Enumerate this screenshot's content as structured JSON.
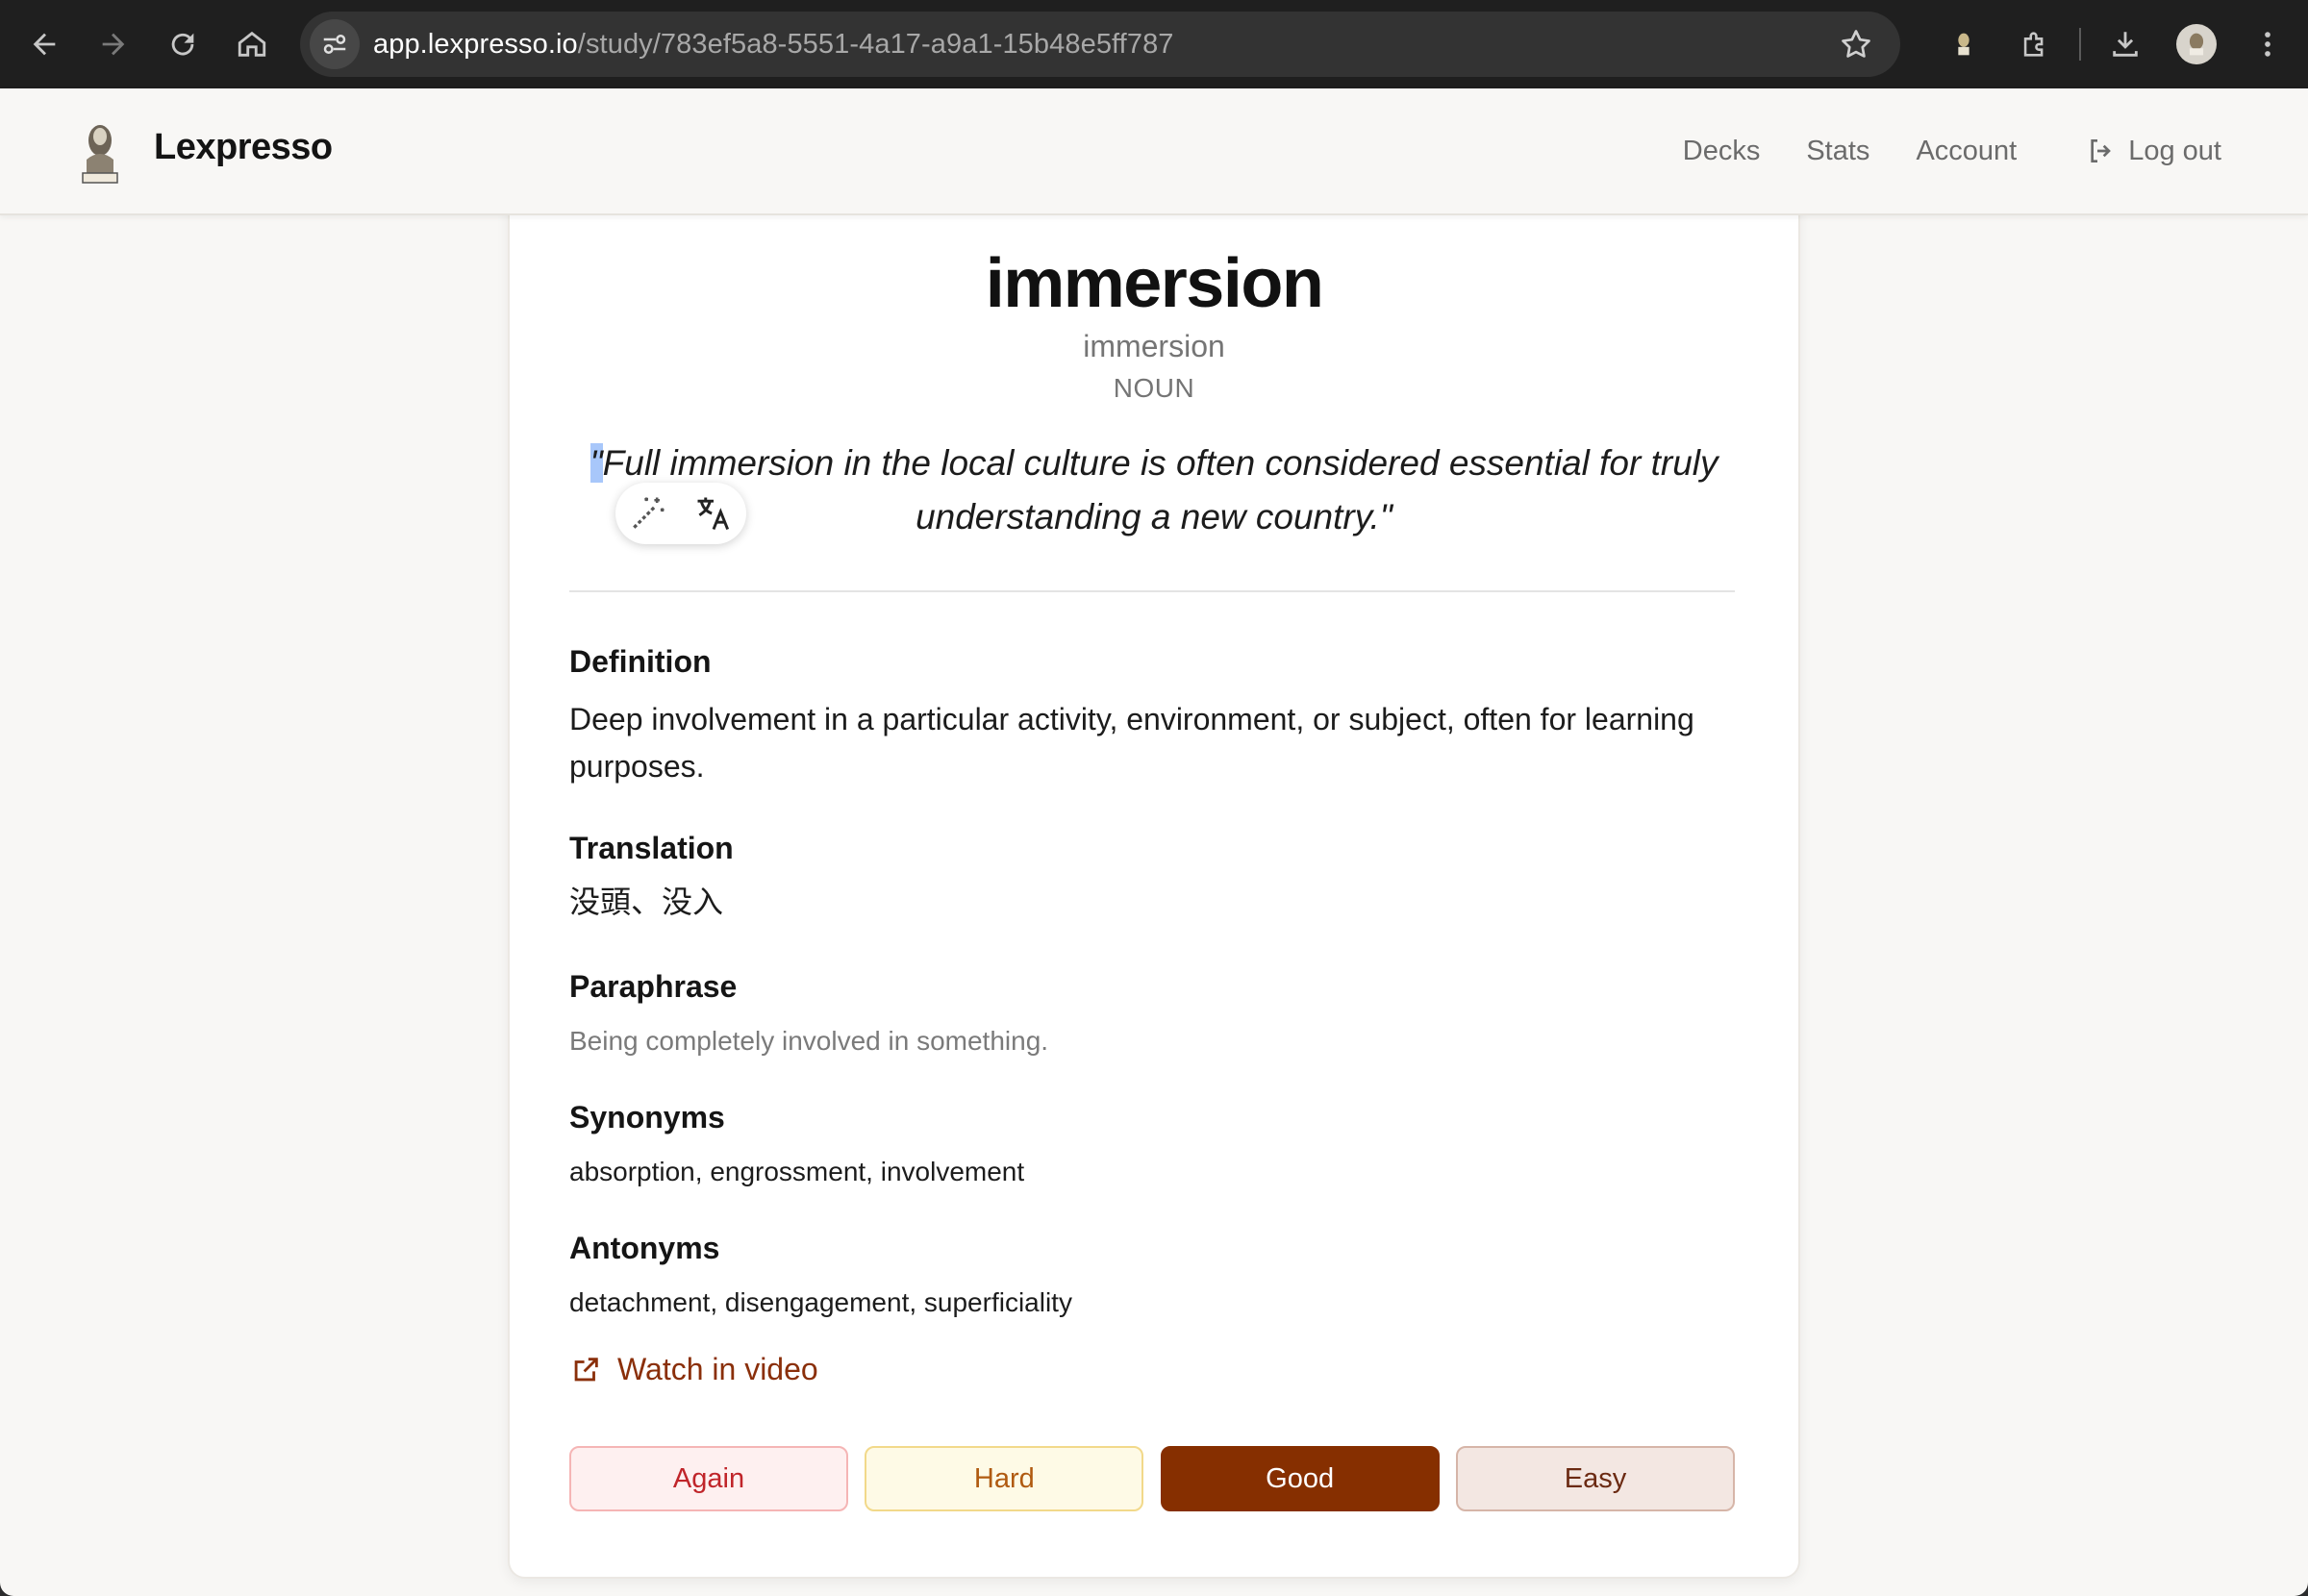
{
  "browser": {
    "url_host": "app.lexpresso.io",
    "url_path": "/study/783ef5a8-5551-4a17-a9a1-15b48e5ff787",
    "icons": [
      "back-icon",
      "forward-icon",
      "reload-icon",
      "home-icon",
      "site-info-icon",
      "star-icon",
      "extension-icon",
      "puzzle-icon",
      "download-icon",
      "profile-avatar",
      "more-icon"
    ]
  },
  "header": {
    "brand": "Lexpresso",
    "nav": {
      "decks": "Decks",
      "stats": "Stats",
      "account": "Account",
      "logout": "Log out"
    }
  },
  "card": {
    "word": "immersion",
    "reading": "immersion",
    "pos": "NOUN",
    "example_quote": "\"",
    "example_rest": "Full immersion in the local culture is often considered essential for truly understanding a new country.\"",
    "sections": {
      "definition": {
        "title": "Definition",
        "body": "Deep involvement in a particular activity, environment, or subject, often for learning purposes."
      },
      "translation": {
        "title": "Translation",
        "body": "没頭、没入"
      },
      "paraphrase": {
        "title": "Paraphrase",
        "body": "Being completely involved in something."
      },
      "synonyms": {
        "title": "Synonyms",
        "body": "absorption, engrossment, involvement"
      },
      "antonyms": {
        "title": "Antonyms",
        "body": "detachment, disengagement, superficiality"
      }
    },
    "video_link": "Watch in video",
    "grades": {
      "again": "Again",
      "hard": "Hard",
      "good": "Good",
      "easy": "Easy"
    }
  },
  "colors": {
    "accent": "#862f00",
    "link": "#8a2f0a",
    "again": "#c0252a",
    "hard": "#b05a10"
  }
}
